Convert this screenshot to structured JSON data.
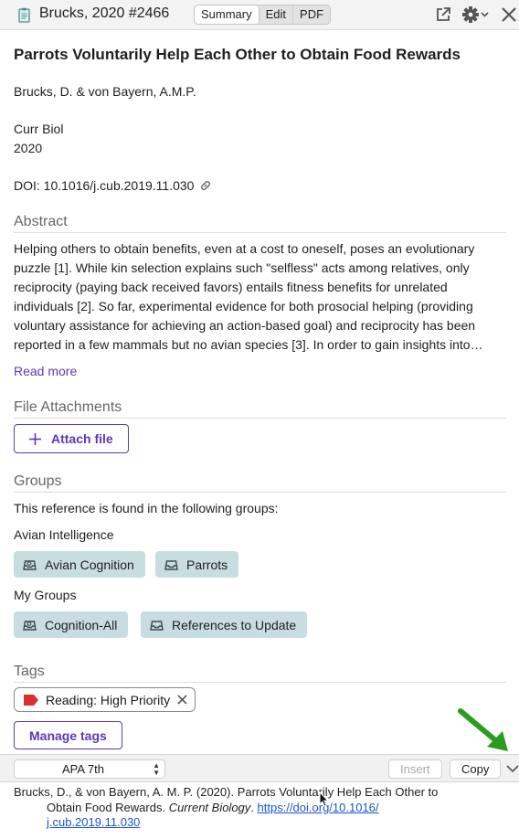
{
  "header": {
    "ref_title": "Brucks, 2020 #2466",
    "tabs": [
      {
        "label": "Summary",
        "active": true
      },
      {
        "label": "Edit",
        "active": false
      },
      {
        "label": "PDF",
        "active": false
      }
    ],
    "icons": [
      "document-icon",
      "open-external-icon",
      "gear-icon",
      "close-icon"
    ]
  },
  "reference": {
    "title": "Parrots Voluntarily Help Each Other to Obtain Food Rewards",
    "authors": "Brucks, D. & von Bayern, A.M.P.",
    "journal": "Curr Biol",
    "year": "2020",
    "doi": "DOI: 10.1016/j.cub.2019.11.030"
  },
  "abstract": {
    "heading": "Abstract",
    "lines": [
      "Helping others to obtain benefits, even at a cost to oneself, poses an evolutionary",
      "puzzle [1]. While kin selection explains such \"selfless\" acts among relatives, only",
      "reciprocity (paying back received favors) entails fitness benefits for unrelated",
      "individuals [2]. So far, experimental evidence for both prosocial helping (providing",
      "voluntary assistance for achieving an action-based goal) and reciprocity has been",
      "reported in a few mammals but no avian species [3]. In order to gain insights into…"
    ],
    "read_more": "Read more"
  },
  "attachments": {
    "heading": "File Attachments",
    "button": "Attach file"
  },
  "groups": {
    "heading": "Groups",
    "intro": "This reference is found in the following groups:",
    "sets": [
      {
        "name": "Avian Intelligence",
        "groups": [
          "Avian Cognition",
          "Parrots"
        ]
      },
      {
        "name": "My Groups",
        "groups": [
          "Cognition-All",
          "References to Update"
        ]
      }
    ]
  },
  "tags": {
    "heading": "Tags",
    "items": [
      {
        "label": "Reading: High Priority",
        "color": "#d92f2f"
      }
    ],
    "manage": "Manage tags"
  },
  "citation_bar": {
    "style": "APA 7th",
    "insert": "Insert",
    "copy": "Copy"
  },
  "citation": {
    "part1": "Brucks, D., & von Bayern, A. M. P. (2020). Parrots Voluntarily Help Each Other to",
    "part2": "Obtain Food Rewards. ",
    "journal": "Current Biology",
    "part3": ". ",
    "url1": "https://doi.org/10.1016/",
    "url2": "j.cub.2019.11.030"
  },
  "colors": {
    "accent": "#5b39b8",
    "group_chip": "#c8dde0",
    "annotation_arrow": "#2a9d1f",
    "link": "#1a55c8"
  }
}
